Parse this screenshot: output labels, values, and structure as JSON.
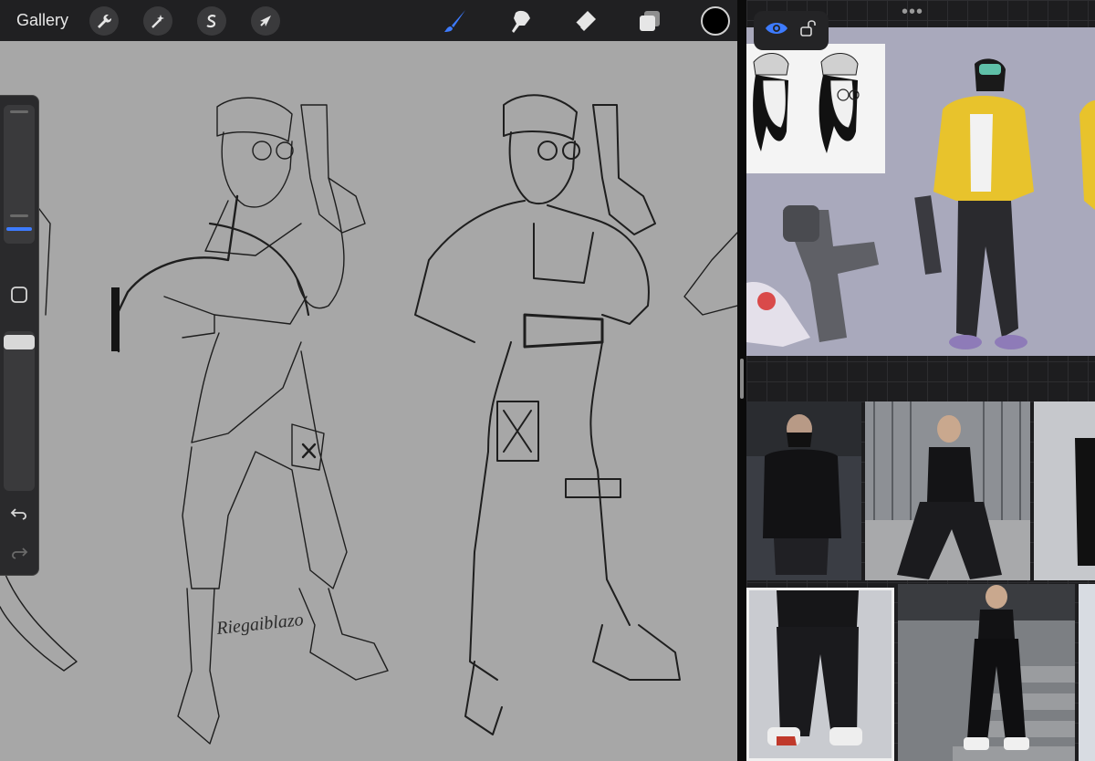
{
  "toolbar": {
    "gallery_label": "Gallery",
    "actions": [
      {
        "name": "actions",
        "icon": "wrench-icon"
      },
      {
        "name": "adjustments",
        "icon": "magic-wand-icon"
      },
      {
        "name": "selection",
        "icon": "selection-s-icon"
      },
      {
        "name": "transform",
        "icon": "cursor-arrow-icon"
      }
    ],
    "tools": [
      {
        "name": "brush",
        "icon": "brush-icon",
        "active": true
      },
      {
        "name": "smudge",
        "icon": "smudge-icon",
        "active": false
      },
      {
        "name": "eraser",
        "icon": "eraser-icon",
        "active": false
      },
      {
        "name": "layers",
        "icon": "layers-icon",
        "active": false
      }
    ],
    "current_color": "#000000",
    "accent_color": "#3d7bff"
  },
  "sidebar": {
    "brush_size_level": 0.2,
    "opacity_level": 1.0,
    "buttons": [
      "modify-square-icon",
      "undo-icon",
      "redo-icon"
    ]
  },
  "canvas": {
    "background": "#a7a7a7",
    "signature_text": "Riegaiblazo"
  },
  "reference": {
    "top_handle": "•••",
    "toolbar_icons": [
      "eye-icon",
      "unlock-icon"
    ]
  }
}
